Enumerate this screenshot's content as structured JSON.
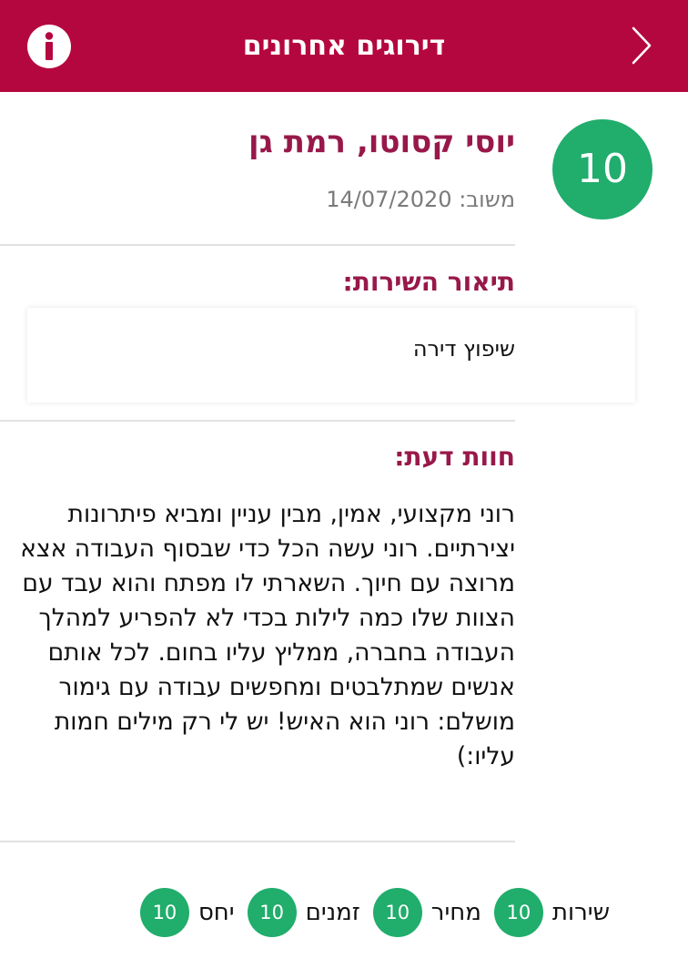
{
  "header": {
    "title": "דירוגים אחרונים",
    "back_icon": "chevron-right-icon",
    "info_icon": "info-icon",
    "background_color": "#b5073f"
  },
  "review": {
    "score": "10",
    "reviewer": "יוסי קסוטו, רמת גן",
    "reply_date": "משוב: 14/07/2020",
    "service_title": "תיאור השירות:",
    "service_description": "שיפוץ דירה",
    "opinion_title": "חוות דעת:",
    "opinion_text": "רוני מקצועי, אמין, מבין עניין ומביא פיתרונות יצירתיים. רוני עשה הכל כדי שבסוף העבודה אצא מרוצה עם חיוך. השארתי לו מפתח והוא עבד עם הצוות שלו כמה לילות בכדי לא להפריע למהלך העבודה בחברה, ממליץ עליו בחום. לכל אותם אנשים שמתלבטים ומחפשים עבודה עם גימור מושלם: רוני הוא האיש! יש לי רק מילים חמות עליו:)"
  },
  "ratings": [
    {
      "label": "שירות",
      "value": "10"
    },
    {
      "label": "מחיר",
      "value": "10"
    },
    {
      "label": "זמנים",
      "value": "10"
    },
    {
      "label": "יחס",
      "value": "10"
    }
  ],
  "colors": {
    "accent": "#b5073f",
    "title_text": "#98184a",
    "score_green": "#21ad6c"
  }
}
